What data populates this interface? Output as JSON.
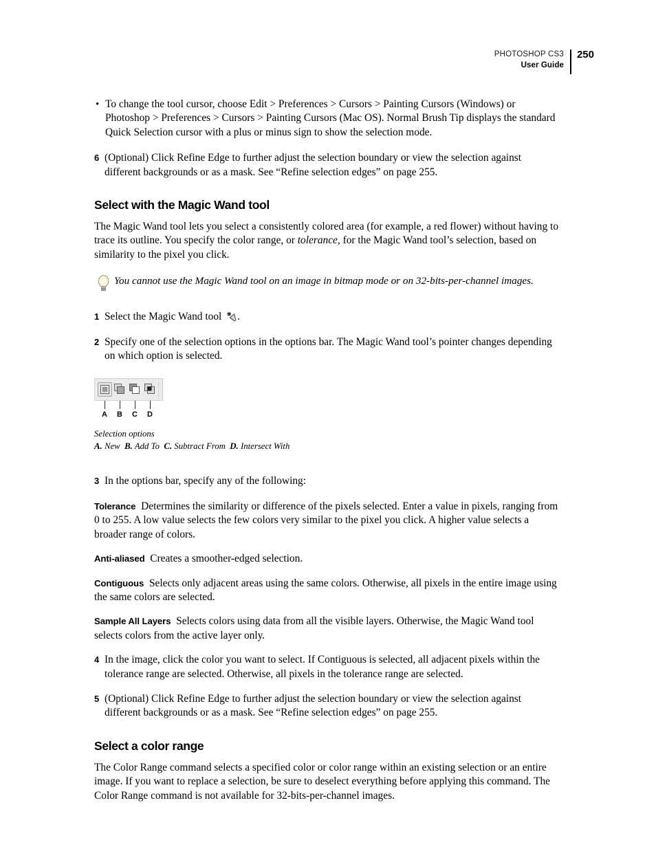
{
  "header": {
    "product": "PHOTOSHOP CS3",
    "doc_type": "User Guide",
    "page_number": "250"
  },
  "content": {
    "bullet_1": "To change the tool cursor, choose Edit > Preferences > Cursors > Painting Cursors (Windows) or Photoshop > Preferences > Cursors > Painting Cursors (Mac OS). Normal Brush Tip displays the standard Quick Selection cursor with a plus or minus sign to show the selection mode.",
    "step_6_num": "6",
    "step_6_text": "(Optional) Click Refine Edge to further adjust the selection boundary or view the selection against different backgrounds or as a mask. See “Refine selection edges” on page 255.",
    "heading_magic_wand": "Select with the Magic Wand tool",
    "magic_wand_intro_a": "The Magic Wand tool lets you select a consistently colored area (for example, a red flower) without having to trace its outline. You specify the color range, or ",
    "magic_wand_intro_italic": "tolerance",
    "magic_wand_intro_b": ", for the Magic Wand tool’s selection, based on similarity to the pixel you click.",
    "tip_note": "You cannot use the Magic Wand tool on an image in bitmap mode or on 32-bits-per-channel images.",
    "step_1_num": "1",
    "step_1_text_a": "Select the Magic Wand tool",
    "step_1_text_b": ".",
    "step_2_num": "2",
    "step_2_text": "Specify one of the selection options in the options bar. The Magic Wand tool’s pointer changes depending on which option is selected.",
    "step_3_num": "3",
    "step_3_text": "In the options bar, specify any of the following:",
    "tolerance_label": "Tolerance",
    "tolerance_text": "Determines the similarity or difference of the pixels selected. Enter a value in pixels, ranging from 0 to 255. A low value selects the few colors very similar to the pixel you click. A higher value selects a broader range of colors.",
    "antialiased_label": "Anti-aliased",
    "antialiased_text": "Creates a smoother-edged selection.",
    "contiguous_label": "Contiguous",
    "contiguous_text": "Selects only adjacent areas using the same colors. Otherwise, all pixels in the entire image using the same colors are selected.",
    "sample_all_layers_label": "Sample All Layers",
    "sample_all_layers_text": "Selects colors using data from all the visible layers. Otherwise, the Magic Wand tool selects colors from the active layer only.",
    "step_4_num": "4",
    "step_4_text": "In the image, click the color you want to select. If Contiguous is selected, all adjacent pixels within the tolerance range are selected. Otherwise, all pixels in the tolerance range are selected.",
    "step_5_num": "5",
    "step_5_text": "(Optional) Click Refine Edge to further adjust the selection boundary or view the selection against different backgrounds or as a mask. See “Refine selection edges” on page 255.",
    "heading_color_range": "Select a color range",
    "color_range_text": "The Color Range command selects a specified color or color range within an existing selection or an entire image. If you want to replace a selection, be sure to deselect everything before applying this command. The Color Range command is not available for 32-bits-per-channel images."
  },
  "figure": {
    "callout_labels": [
      "A",
      "B",
      "C",
      "D"
    ],
    "caption_title": "Selection options",
    "caption_items": [
      {
        "letter": "A.",
        "label": "New"
      },
      {
        "letter": "B.",
        "label": "Add To"
      },
      {
        "letter": "C.",
        "label": "Subtract From"
      },
      {
        "letter": "D.",
        "label": "Intersect With"
      }
    ],
    "buttons": [
      {
        "name": "new-selection",
        "selected": true
      },
      {
        "name": "add-to-selection",
        "selected": false
      },
      {
        "name": "subtract-from-selection",
        "selected": false
      },
      {
        "name": "intersect-with-selection",
        "selected": false
      }
    ]
  },
  "colors": {
    "page_background": "#ffffff",
    "text": "#000000",
    "options_bar_background": "#ececec",
    "options_bar_border": "#d3d3d3",
    "selected_button_border": "#9aa7b4",
    "bulb_glass": "#f7f0c8",
    "bulb_base": "#8f8f8f"
  }
}
